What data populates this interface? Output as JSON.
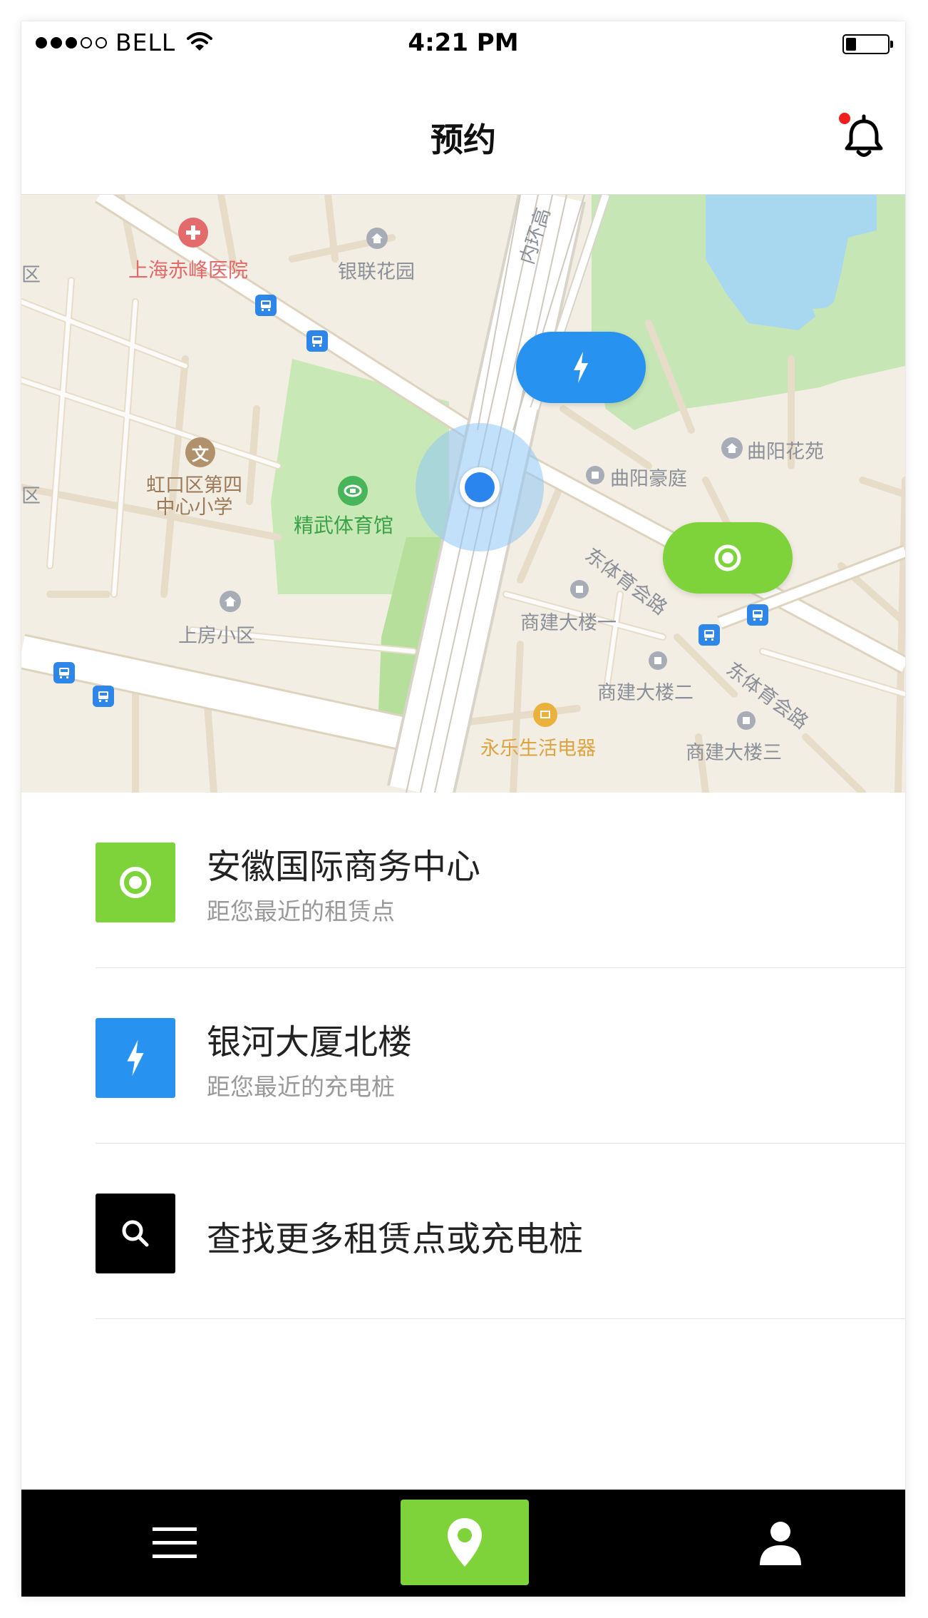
{
  "status_bar": {
    "carrier": "BELL",
    "time": "4:21 PM",
    "signal_bars_filled": 3,
    "signal_bars_total": 5,
    "battery_level": 0.25
  },
  "nav": {
    "title": "预约",
    "bell_icon": "bell-icon",
    "has_notification": true,
    "notification_color": "#f01e1e"
  },
  "map": {
    "labels": {
      "hospital": "上海赤峰医院",
      "yinlian": "银联花园",
      "school": "虹口区第四\n中心小学",
      "stadium": "精武体育馆",
      "shangfang": "上房小区",
      "quyang_garden": "曲阳花苑",
      "quyang_haoting": "曲阳豪庭",
      "building1": "商建大楼一",
      "building2": "商建大楼二",
      "building3": "商建大楼三",
      "yongle": "永乐生活电器",
      "road1": "东体育会路",
      "road2": "东体育会路",
      "ring_road": "内环高",
      "edge1": "区",
      "edge2": "区"
    },
    "colors": {
      "charger_pin": "#2792f0",
      "rental_pin": "#7ed23a",
      "user_location": "#2a86ee"
    }
  },
  "list": [
    {
      "title": "安徽国际商务中心",
      "subtitle": "距您最近的租赁点",
      "icon": "rental-point-icon",
      "color": "#7ed23a"
    },
    {
      "title": "银河大厦北楼",
      "subtitle": "距您最近的充电桩",
      "icon": "lightning-icon",
      "color": "#2792f0"
    },
    {
      "title": "查找更多租赁点或充电桩",
      "subtitle": "",
      "icon": "search-icon",
      "color": "#000000"
    }
  ],
  "tabbar": {
    "items": [
      "menu-icon",
      "location-pin-icon",
      "user-icon"
    ],
    "active_color": "#7ed23a"
  }
}
